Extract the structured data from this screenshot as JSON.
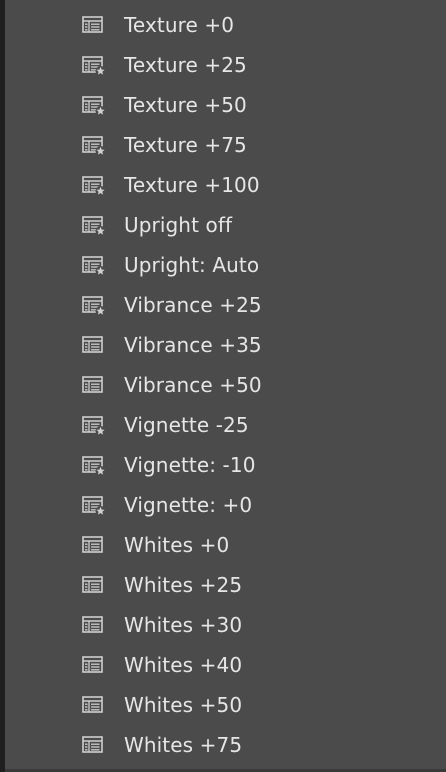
{
  "presets": {
    "items": [
      {
        "label": "Texture +0",
        "icon": "preset-icon"
      },
      {
        "label": "Texture +25",
        "icon": "preset-user-icon"
      },
      {
        "label": "Texture +50",
        "icon": "preset-user-icon"
      },
      {
        "label": "Texture +75",
        "icon": "preset-user-icon"
      },
      {
        "label": "Texture +100",
        "icon": "preset-user-icon"
      },
      {
        "label": "Upright off",
        "icon": "preset-user-icon"
      },
      {
        "label": "Upright: Auto",
        "icon": "preset-user-icon"
      },
      {
        "label": "Vibrance +25",
        "icon": "preset-user-icon"
      },
      {
        "label": "Vibrance +35",
        "icon": "preset-icon"
      },
      {
        "label": "Vibrance +50",
        "icon": "preset-icon"
      },
      {
        "label": "Vignette -25",
        "icon": "preset-user-icon"
      },
      {
        "label": "Vignette: -10",
        "icon": "preset-user-icon"
      },
      {
        "label": "Vignette: +0",
        "icon": "preset-user-icon"
      },
      {
        "label": "Whites +0",
        "icon": "preset-icon"
      },
      {
        "label": "Whites +25",
        "icon": "preset-icon"
      },
      {
        "label": "Whites +30",
        "icon": "preset-icon"
      },
      {
        "label": "Whites +40",
        "icon": "preset-icon"
      },
      {
        "label": "Whites +50",
        "icon": "preset-icon"
      },
      {
        "label": "Whites +75",
        "icon": "preset-icon"
      }
    ]
  },
  "colors": {
    "panel_bg": "#4b4b4b",
    "text": "#e6e6e6",
    "icon": "#cfcfcf",
    "left_border": "#1f1f1f"
  }
}
